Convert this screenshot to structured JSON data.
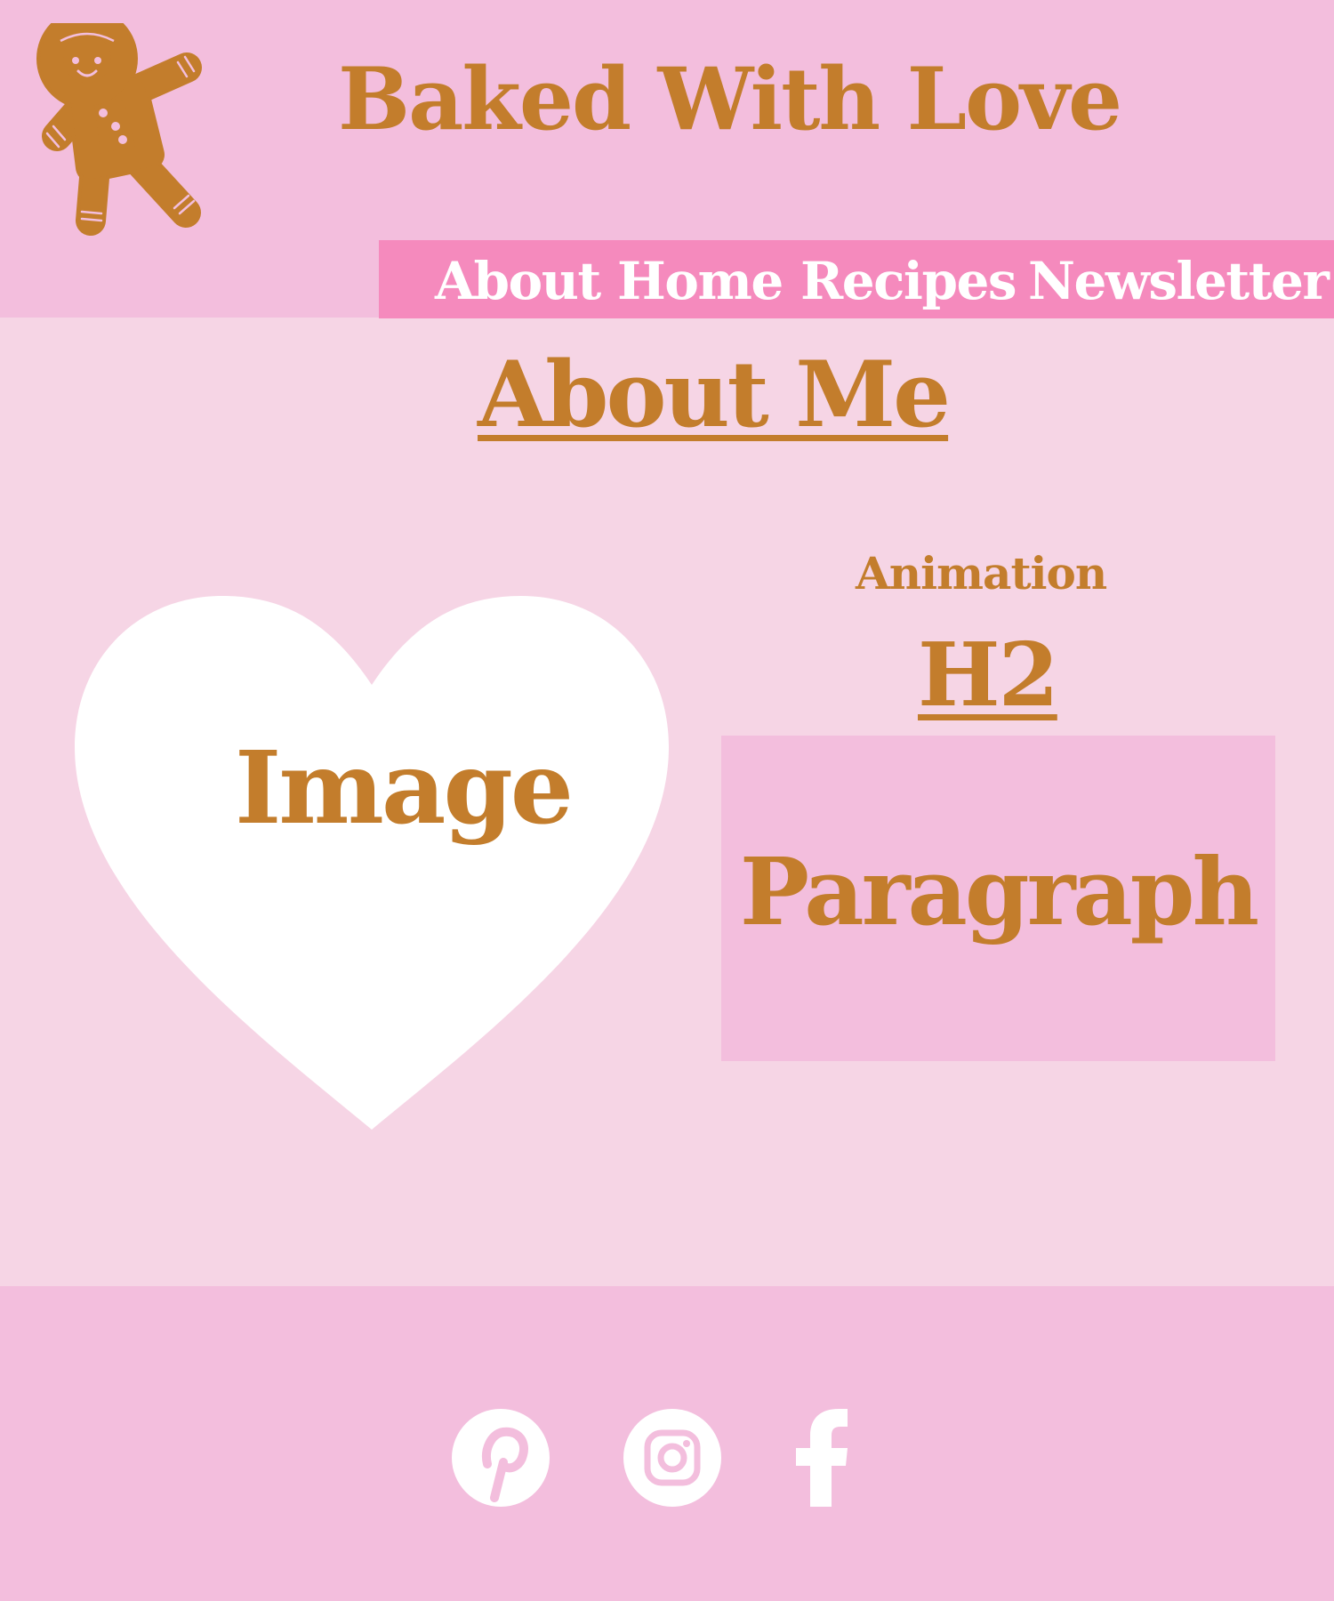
{
  "header": {
    "site_title": "Baked With Love",
    "logo_icon": "gingerbread-man-icon"
  },
  "nav": {
    "items": [
      {
        "label": "About"
      },
      {
        "label": "Home"
      },
      {
        "label": "Recipes"
      },
      {
        "label": "Newsletter"
      }
    ]
  },
  "main": {
    "page_title": "About Me",
    "image_placeholder": "Image",
    "image_shape_icon": "heart-icon",
    "animation_label": "Animation",
    "heading_placeholder": "H2",
    "paragraph_placeholder": "Paragraph"
  },
  "footer": {
    "social_icons": [
      "pinterest-icon",
      "instagram-icon",
      "facebook-icon"
    ]
  },
  "colors": {
    "page_background": "#f6d5e5",
    "header_background": "#f3bedd",
    "nav_background": "#f58abd",
    "accent_brown": "#c37d2c",
    "white": "#ffffff"
  }
}
